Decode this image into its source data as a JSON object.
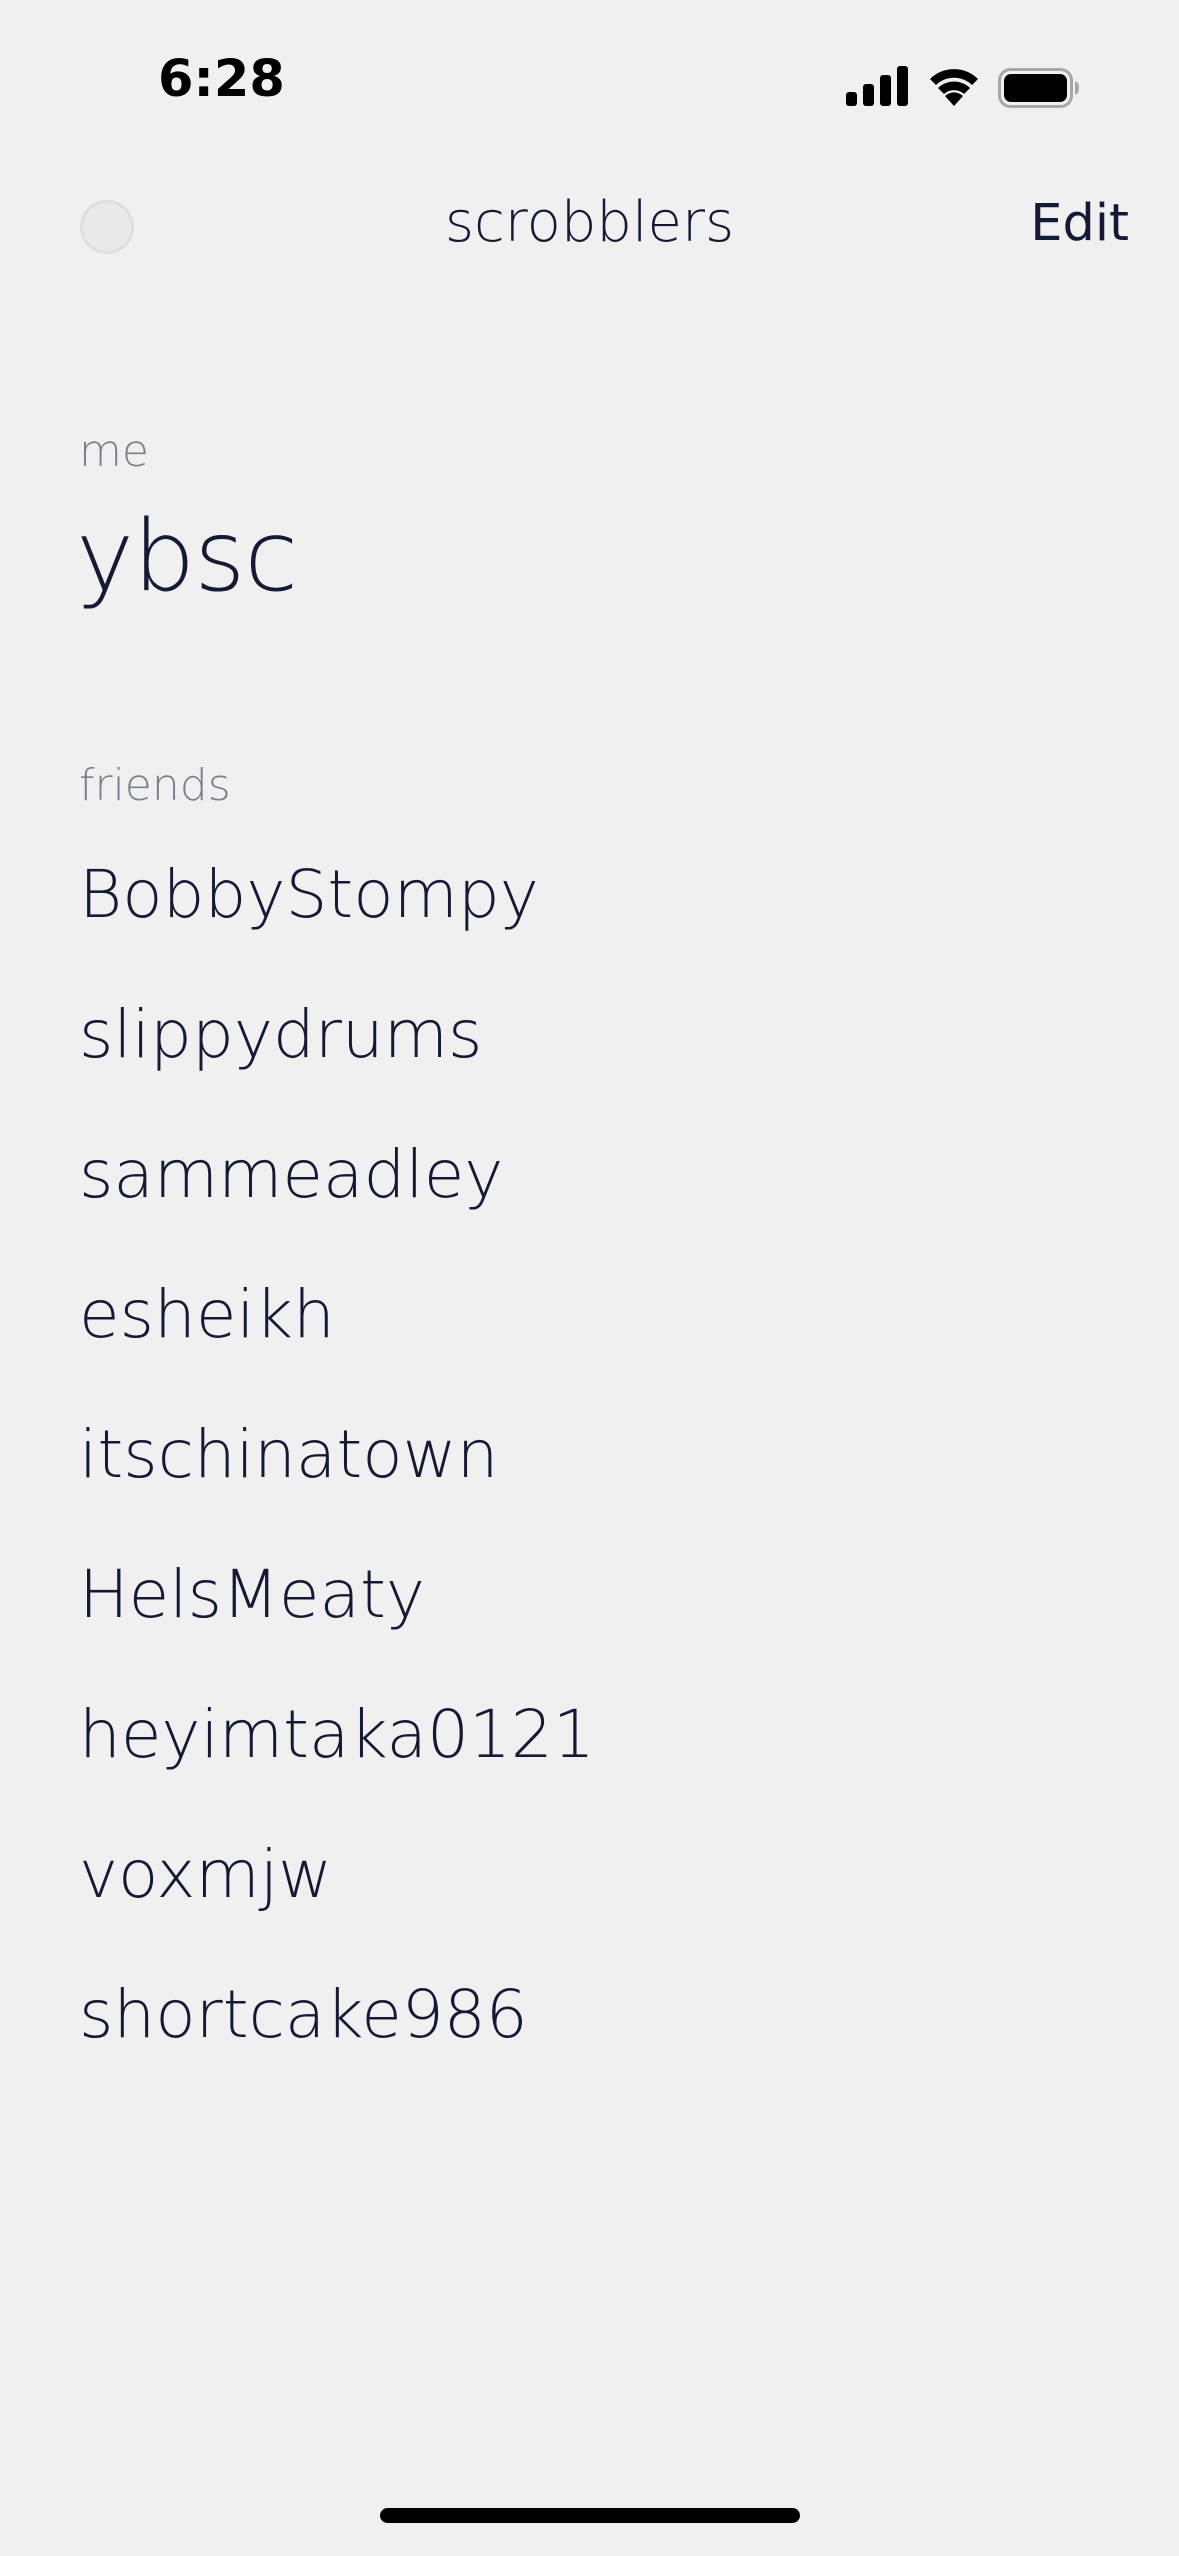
{
  "status_bar": {
    "time": "6:28",
    "icons": [
      "cellular-signal-icon",
      "wifi-icon",
      "battery-icon"
    ]
  },
  "nav": {
    "title": "scrobblers",
    "edit_label": "Edit",
    "avatar_icon": "avatar"
  },
  "me": {
    "label": "me",
    "username": "ybsc"
  },
  "friends": {
    "label": "friends",
    "items": [
      "BobbyStompy",
      "slippydrums",
      "sammeadley",
      "esheikh",
      "itschinatown",
      "HelsMeaty",
      "heyimtaka0121",
      "voxmjw",
      "shortcake986"
    ]
  },
  "colors": {
    "background": "#f0f0f0",
    "text": "#141a33",
    "muted": "#7b7f8a"
  }
}
